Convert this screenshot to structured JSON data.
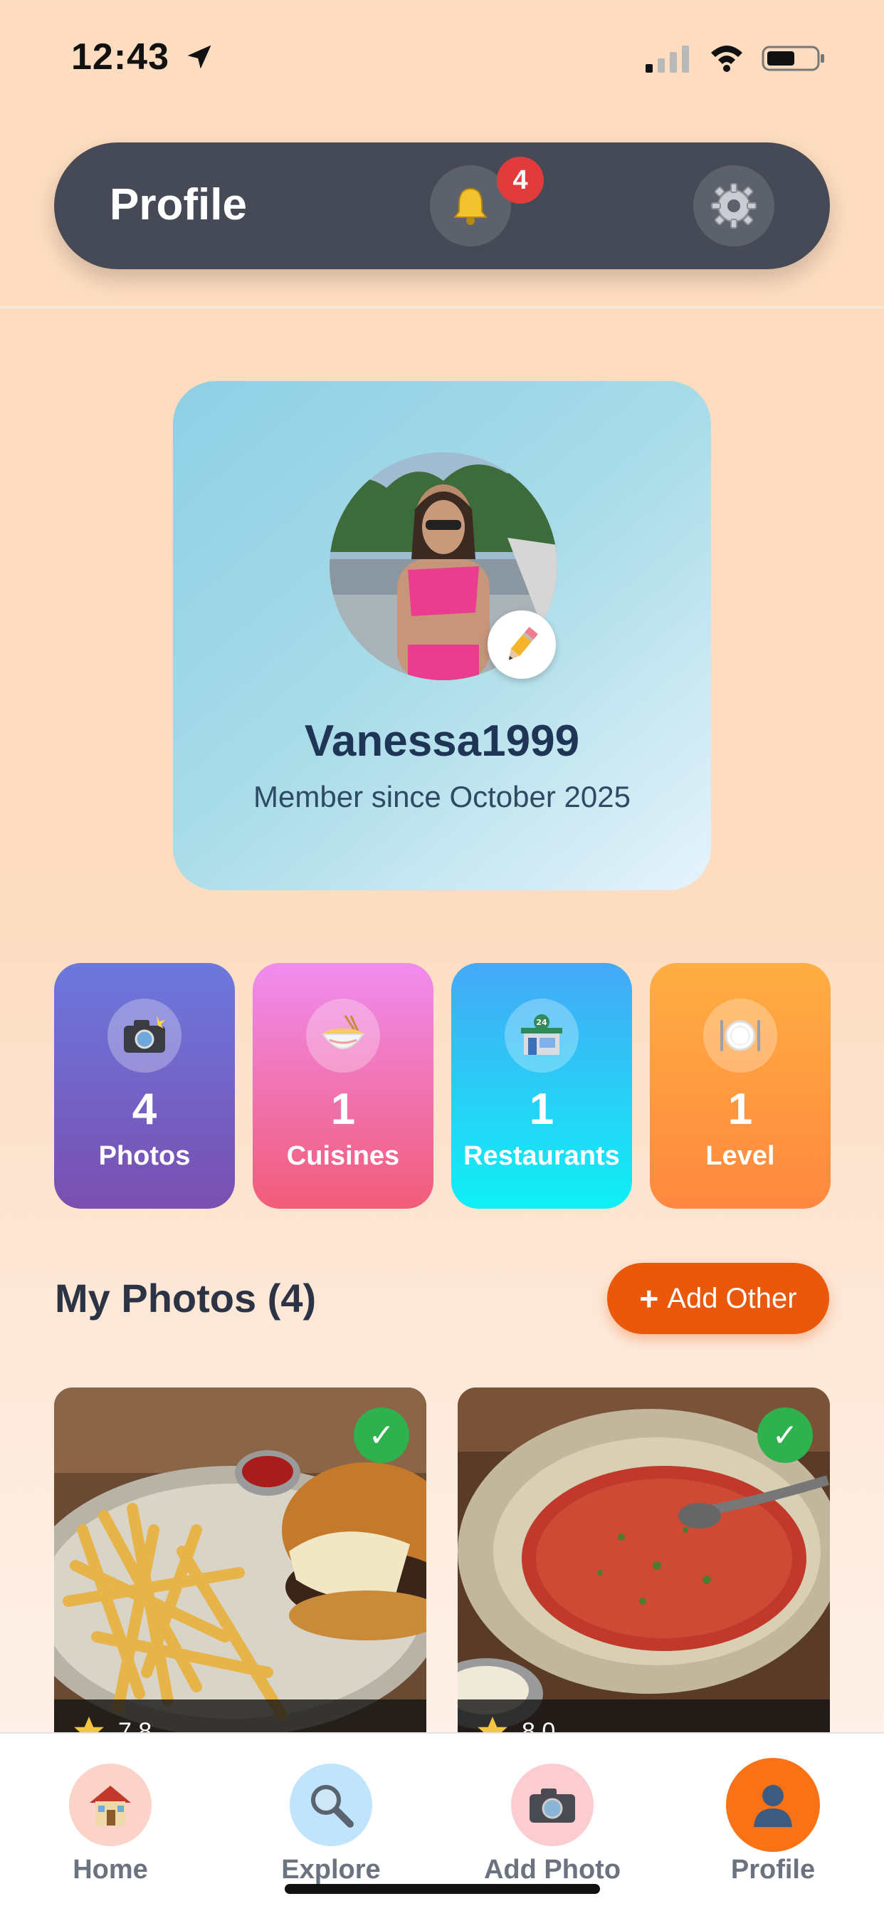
{
  "status_bar": {
    "time": "12:43"
  },
  "header": {
    "title": "Profile",
    "notification_count": "4"
  },
  "profile": {
    "username": "Vanessa1999",
    "member_since": "Member since October 2025"
  },
  "stats": [
    {
      "value": "4",
      "label": "Photos",
      "icon": "camera-flash-icon"
    },
    {
      "value": "1",
      "label": "Cuisines",
      "icon": "noodle-bowl-icon"
    },
    {
      "value": "1",
      "label": "Restaurants",
      "icon": "store-24-icon"
    },
    {
      "value": "1",
      "label": "Level",
      "icon": "plate-cutlery-icon"
    }
  ],
  "photos_section": {
    "title": "My Photos (4)",
    "add_label": "Add Other"
  },
  "photos": [
    {
      "rating": "7.8",
      "dish": "burger-and-fries",
      "verified": true
    },
    {
      "rating": "8.0",
      "dish": "tomato-soup",
      "verified": true
    }
  ],
  "nav": [
    {
      "label": "Home",
      "icon": "house-icon"
    },
    {
      "label": "Explore",
      "icon": "magnifier-icon"
    },
    {
      "label": "Add Photo",
      "icon": "camera-icon"
    },
    {
      "label": "Profile",
      "icon": "user-silhouette-icon",
      "active": true
    }
  ],
  "colors": {
    "accent": "#ea580c",
    "header_bg": "#464a56",
    "verified": "#2fb14e",
    "badge": "#e23b3b"
  }
}
